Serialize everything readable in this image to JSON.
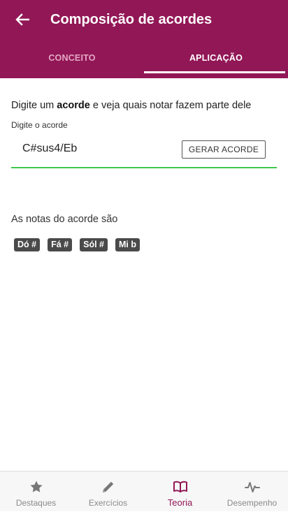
{
  "header": {
    "title": "Composição de acordes",
    "tabs": [
      {
        "label": "CONCEITO"
      },
      {
        "label": "APLICAÇÃO"
      }
    ],
    "active_tab": "APLICAÇÃO"
  },
  "form": {
    "intro_prefix": "Digite um ",
    "intro_bold": "acorde",
    "intro_suffix": " e veja quais notar fazem parte dele",
    "field_label": "Digite o acorde",
    "input_value": "C#sus4/Eb",
    "generate_button": "GERAR ACORDE"
  },
  "result": {
    "label": "As notas do acorde são",
    "notes": [
      "Dó #",
      "Fá #",
      "Sól #",
      "Mi b"
    ]
  },
  "bottom_nav": {
    "items": [
      {
        "label": "Destaques",
        "icon": "star-icon"
      },
      {
        "label": "Exercícios",
        "icon": "pencil-icon"
      },
      {
        "label": "Teoria",
        "icon": "book-icon"
      },
      {
        "label": "Desempenho",
        "icon": "pulse-icon"
      }
    ],
    "active": "Teoria"
  },
  "colors": {
    "primary": "#921756",
    "inactive_tab": "#e4a8c5",
    "input_underline": "#3ec74e",
    "note_chip": "#4a4a4a",
    "nav_inactive": "#8a8a8a"
  }
}
